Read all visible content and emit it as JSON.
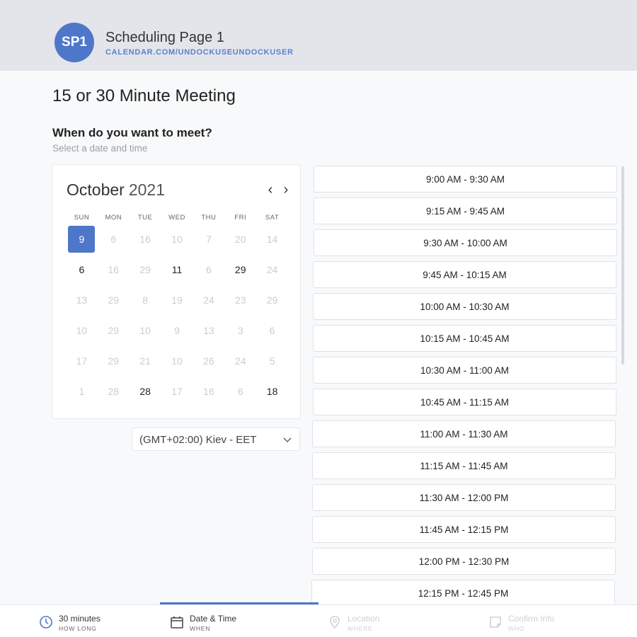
{
  "header": {
    "avatar_initials": "SP1",
    "page_name": "Scheduling Page 1",
    "page_url": "CALENDAR.COM/UNDOCKUSEUNDOCKUSER"
  },
  "meeting_title": "15 or 30 Minute Meeting",
  "question": "When do you want to meet?",
  "subhint": "Select a date and time",
  "calendar": {
    "month": "October",
    "year": "2021",
    "prev_icon": "chevron-left-icon",
    "next_icon": "chevron-right-icon",
    "weekdays": [
      "SUN",
      "MON",
      "TUE",
      "WED",
      "THU",
      "FRI",
      "SAT"
    ],
    "days": [
      {
        "label": "9",
        "state": "selected"
      },
      {
        "label": "6",
        "state": "disabled"
      },
      {
        "label": "16",
        "state": "disabled"
      },
      {
        "label": "10",
        "state": "disabled"
      },
      {
        "label": "7",
        "state": "disabled"
      },
      {
        "label": "20",
        "state": "disabled"
      },
      {
        "label": "14",
        "state": "disabled"
      },
      {
        "label": "6",
        "state": "available"
      },
      {
        "label": "16",
        "state": "disabled"
      },
      {
        "label": "29",
        "state": "disabled"
      },
      {
        "label": "11",
        "state": "available"
      },
      {
        "label": "6",
        "state": "disabled"
      },
      {
        "label": "29",
        "state": "available"
      },
      {
        "label": "24",
        "state": "disabled"
      },
      {
        "label": "13",
        "state": "disabled"
      },
      {
        "label": "29",
        "state": "disabled"
      },
      {
        "label": "8",
        "state": "disabled"
      },
      {
        "label": "19",
        "state": "disabled"
      },
      {
        "label": "24",
        "state": "disabled"
      },
      {
        "label": "23",
        "state": "disabled"
      },
      {
        "label": "29",
        "state": "disabled"
      },
      {
        "label": "10",
        "state": "disabled"
      },
      {
        "label": "29",
        "state": "disabled"
      },
      {
        "label": "10",
        "state": "disabled"
      },
      {
        "label": "9",
        "state": "disabled"
      },
      {
        "label": "13",
        "state": "disabled"
      },
      {
        "label": "3",
        "state": "disabled"
      },
      {
        "label": "6",
        "state": "disabled"
      },
      {
        "label": "17",
        "state": "disabled"
      },
      {
        "label": "29",
        "state": "disabled"
      },
      {
        "label": "21",
        "state": "disabled"
      },
      {
        "label": "10",
        "state": "disabled"
      },
      {
        "label": "26",
        "state": "disabled"
      },
      {
        "label": "24",
        "state": "disabled"
      },
      {
        "label": "5",
        "state": "disabled"
      },
      {
        "label": "1",
        "state": "disabled"
      },
      {
        "label": "28",
        "state": "disabled"
      },
      {
        "label": "28",
        "state": "available"
      },
      {
        "label": "17",
        "state": "disabled"
      },
      {
        "label": "16",
        "state": "disabled"
      },
      {
        "label": "6",
        "state": "disabled"
      },
      {
        "label": "18",
        "state": "available"
      }
    ]
  },
  "timezone": {
    "value": "(GMT+02:00) Kiev - EET",
    "icon": "chevron-down-icon"
  },
  "time_slots": [
    "9:00 AM - 9:30 AM",
    "9:15 AM - 9:45 AM",
    "9:30 AM - 10:00 AM",
    "9:45 AM - 10:15 AM",
    "10:00 AM - 10:30 AM",
    "10:15 AM - 10:45 AM",
    "10:30 AM - 11:00 AM",
    "10:45 AM - 11:15 AM",
    "11:00 AM - 11:30 AM",
    "11:15 AM - 11:45 AM",
    "11:30 AM - 12:00 PM",
    "11:45 AM - 12:15 PM",
    "12:00 PM - 12:30 PM",
    "12:15 PM - 12:45 PM"
  ],
  "steps": [
    {
      "label": "30 minutes",
      "sub": "HOW LONG",
      "icon": "clock-icon",
      "state": "done"
    },
    {
      "label": "Date & Time",
      "sub": "WHEN",
      "icon": "calendar-icon",
      "state": "active"
    },
    {
      "label": "Location",
      "sub": "WHERE",
      "icon": "location-pin-icon",
      "state": "disabled"
    },
    {
      "label": "Confirm Info",
      "sub": "WHO",
      "icon": "note-icon",
      "state": "disabled"
    }
  ],
  "colors": {
    "accent": "#4f77c9",
    "header_bg": "#e3e5ea",
    "disabled_text": "#c9cdd3"
  }
}
